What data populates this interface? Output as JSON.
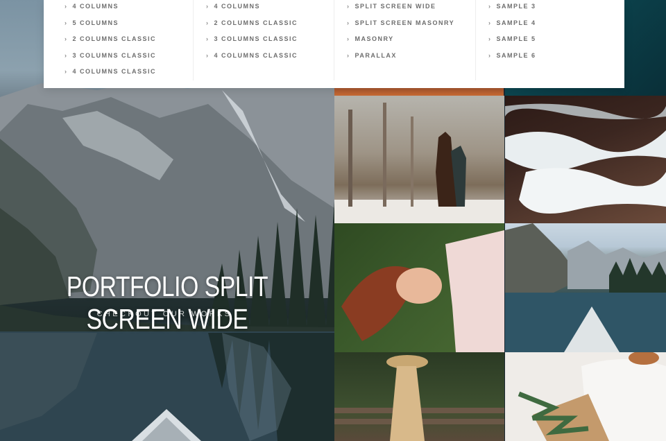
{
  "hero": {
    "title": "PORTFOLIO SPLIT SCREEN WIDE",
    "subtitle": "CHECKOUT OUR WORKS"
  },
  "menu": {
    "columns": [
      {
        "items": [
          "4 COLUMNS",
          "5 COLUMNS",
          "2 COLUMNS CLASSIC",
          "3 COLUMNS CLASSIC",
          "4 COLUMNS CLASSIC"
        ]
      },
      {
        "items": [
          "4 COLUMNS",
          "2 COLUMNS CLASSIC",
          "3 COLUMNS CLASSIC",
          "4 COLUMNS CLASSIC"
        ]
      },
      {
        "items": [
          "SPLIT SCREEN WIDE",
          "SPLIT SCREEN MASONRY",
          "MASONRY",
          "PARALLAX"
        ]
      },
      {
        "items": [
          "SAMPLE 3",
          "SAMPLE 4",
          "SAMPLE 5",
          "SAMPLE 6"
        ]
      }
    ],
    "chevron": "›"
  },
  "colors": {
    "menu_bg": "#ffffff",
    "menu_text": "#6d6d6d",
    "hero_text": "#ffffff"
  },
  "icons": {
    "menu_bullet": "chevron-right-icon"
  }
}
